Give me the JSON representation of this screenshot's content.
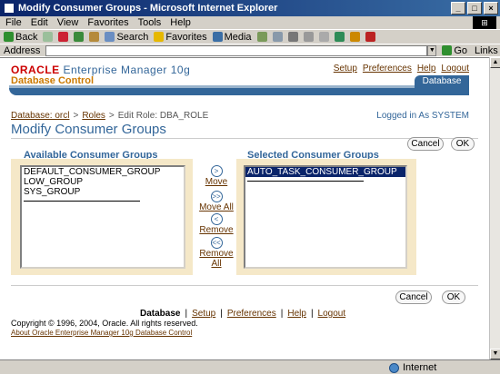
{
  "window": {
    "title": "Modify Consumer Groups - Microsoft Internet Explorer",
    "minimize": "_",
    "maximize": "□",
    "close": "×"
  },
  "menu": [
    "File",
    "Edit",
    "View",
    "Favorites",
    "Tools",
    "Help"
  ],
  "toolbar": {
    "back": "Back",
    "search": "Search",
    "favorites": "Favorites",
    "media": "Media"
  },
  "address": {
    "label": "Address",
    "value": "",
    "go": "Go",
    "links": "Links"
  },
  "header": {
    "brand": "ORACLE",
    "product": "Enterprise Manager 10g",
    "subtitle": "Database Control",
    "global_links": [
      "Setup",
      "Preferences",
      "Help",
      "Logout"
    ],
    "tab": "Database"
  },
  "breadcrumb": {
    "items": [
      "Database: orcl",
      "Roles"
    ],
    "separator": ">",
    "current": "Edit Role: DBA_ROLE"
  },
  "logged_in": "Logged in As SYSTEM",
  "page_title": "Modify Consumer Groups",
  "buttons": {
    "cancel": "Cancel",
    "ok": "OK"
  },
  "available": {
    "title": "Available Consumer Groups",
    "items": [
      "DEFAULT_CONSUMER_GROUP",
      "LOW_GROUP",
      "SYS_GROUP"
    ]
  },
  "selected": {
    "title": "Selected Consumer Groups",
    "items": [
      "AUTO_TASK_CONSUMER_GROUP"
    ]
  },
  "shuttle": {
    "move": "Move",
    "move_all": "Move All",
    "remove": "Remove",
    "remove_all_1": "Remove",
    "remove_all_2": "All",
    "move_glyph": ">",
    "move_all_glyph": ">>",
    "remove_glyph": "<",
    "remove_all_glyph": "<<"
  },
  "footer": {
    "links": [
      "Database",
      "Setup",
      "Preferences",
      "Help",
      "Logout"
    ],
    "separator": "|",
    "copyright": "Copyright © 1996, 2004, Oracle. All rights reserved.",
    "about": "About Oracle Enterprise Manager 10g Database Control"
  },
  "status": {
    "zone": "Internet"
  },
  "colors": {
    "title_bar": "#0a246a",
    "oracle_red": "#cc0000",
    "em_blue": "#336699",
    "link_brown": "#663300",
    "selection": "#0a246a"
  }
}
